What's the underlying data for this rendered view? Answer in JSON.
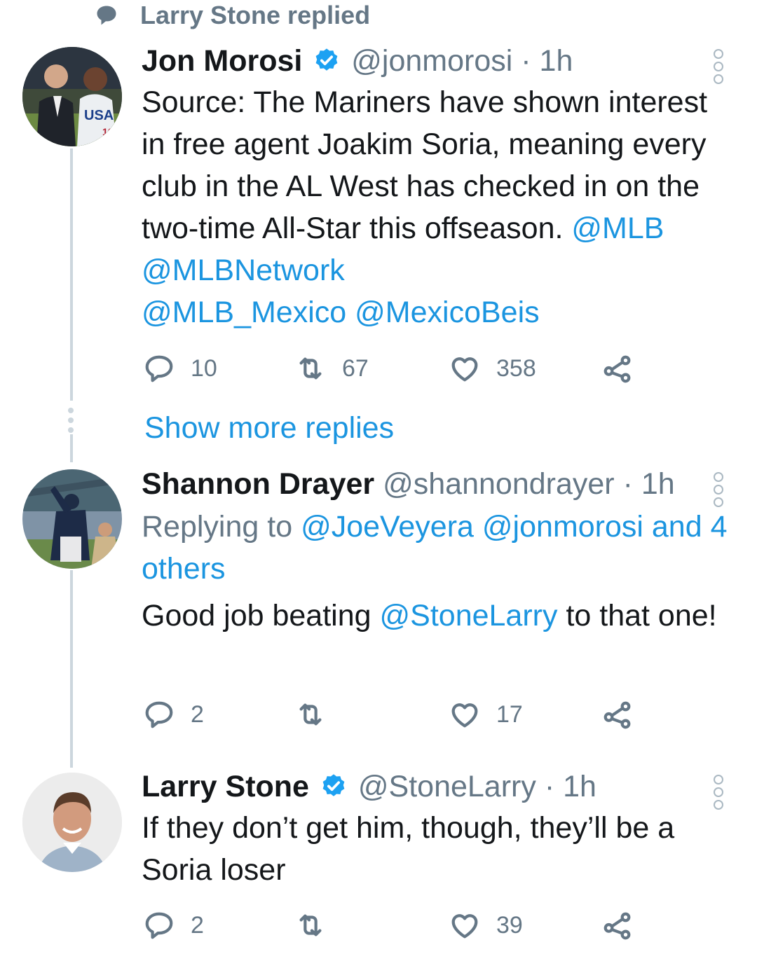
{
  "context": {
    "replied_label": "Larry Stone replied"
  },
  "tweets": [
    {
      "name": "Jon Morosi",
      "verified": true,
      "handle": "@jonmorosi",
      "time": "· 1h",
      "text_parts": [
        "Source: The Mariners have shown interest in free agent Joakim Soria, meaning every club in the AL West has checked in on the two-time All-Star this offseason. ",
        "@MLB",
        " ",
        "@MLBNetwork",
        " ",
        "@MLB_Mexico",
        " ",
        "@MexicoBeis"
      ],
      "actions": {
        "replies": "10",
        "retweets": "67",
        "likes": "358"
      }
    },
    {
      "name": "Shannon Drayer",
      "verified": false,
      "handle": "@shannondrayer",
      "time": "· 1h",
      "replying_prefix": "Replying to ",
      "replying_to": "@JoeVeyera @jonmorosi and 4 others",
      "text_parts": [
        "Good job beating ",
        "@StoneLarry",
        " to that one!"
      ],
      "actions": {
        "replies": "2",
        "retweets": "",
        "likes": "17"
      }
    },
    {
      "name": "Larry Stone",
      "verified": true,
      "handle": "@StoneLarry",
      "time": "· 1h",
      "text_parts": [
        "If they don’t get him, though, they’ll be a Soria loser"
      ],
      "actions": {
        "replies": "2",
        "retweets": "",
        "likes": "39"
      }
    }
  ],
  "show_more": "Show more replies",
  "icons": {
    "context": "speech-bubble-icon",
    "verified": "verified-badge-icon",
    "menu": "more-vertical-icon",
    "reply": "reply-icon",
    "retweet": "retweet-icon",
    "like": "heart-icon",
    "share": "share-icon"
  },
  "colors": {
    "link": "#1b95e0",
    "muted": "#657786",
    "verified": "#1da1f2",
    "thread_line": "#ccd6dd"
  }
}
